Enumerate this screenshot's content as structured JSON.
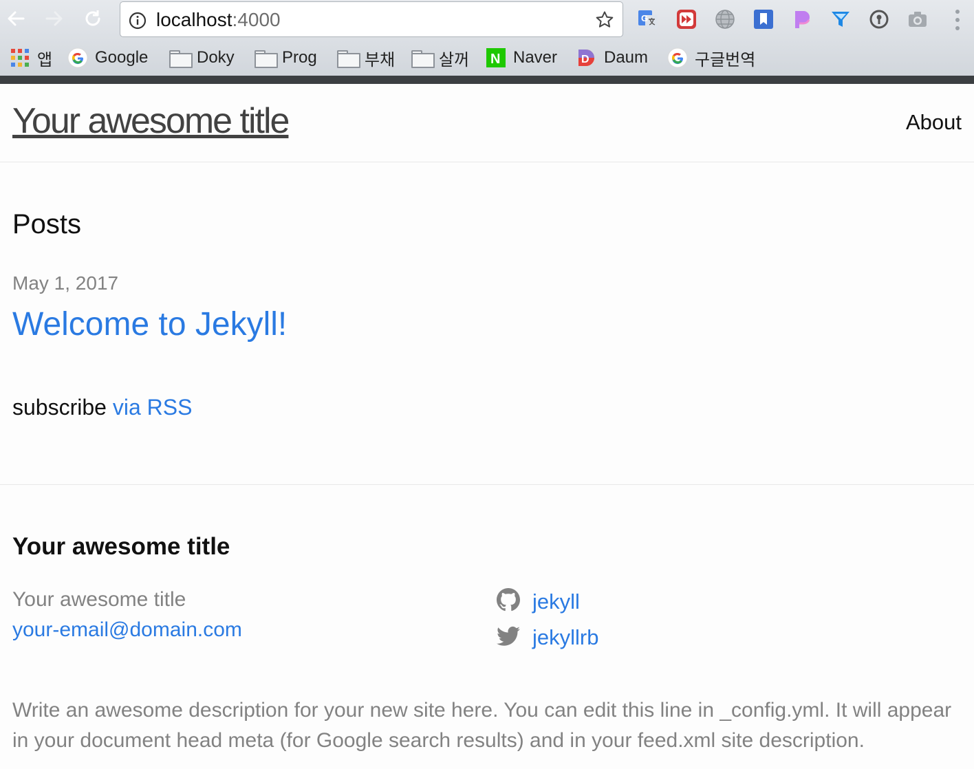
{
  "browser": {
    "url_host": "localhost",
    "url_port": ":4000",
    "bookmarks": [
      {
        "label": "앱",
        "icon": "apps-grid-icon"
      },
      {
        "label": "Google",
        "icon": "google-g-icon"
      },
      {
        "label": "Doky",
        "icon": "folder-icon"
      },
      {
        "label": "Prog",
        "icon": "folder-icon"
      },
      {
        "label": "부채",
        "icon": "folder-icon"
      },
      {
        "label": "살꺼",
        "icon": "folder-icon"
      },
      {
        "label": "Naver",
        "icon": "naver-icon"
      },
      {
        "label": "Daum",
        "icon": "daum-icon"
      },
      {
        "label": "구글번역",
        "icon": "google-g-icon"
      }
    ],
    "naver_glyph": "N",
    "daum_glyph": "D",
    "translate_glyph": "G",
    "extensions": [
      "google-translate-icon",
      "fast-forward-extension-icon",
      "globe-icon",
      "bookmark-extension-icon",
      "p-extension-icon",
      "funnel-extension-icon",
      "password-key-icon",
      "camera-icon"
    ],
    "colors": {
      "accent_link": "#2a7ae2",
      "muted_text": "#828282"
    }
  },
  "header": {
    "site_title": "Your awesome title",
    "nav_about": "About"
  },
  "main": {
    "heading": "Posts",
    "posts": [
      {
        "date": "May 1, 2017",
        "title": "Welcome to Jekyll!"
      }
    ],
    "rss_prefix": "subscribe",
    "rss_link": "via RSS"
  },
  "footer": {
    "heading": "Your awesome title",
    "name": "Your awesome title",
    "email": "your-email@domain.com",
    "github": "jekyll",
    "twitter": "jekyllrb",
    "description": "Write an awesome description for your new site here. You can edit this line in _config.yml. It will appear in your document head meta (for Google search results) and in your feed.xml site description."
  }
}
